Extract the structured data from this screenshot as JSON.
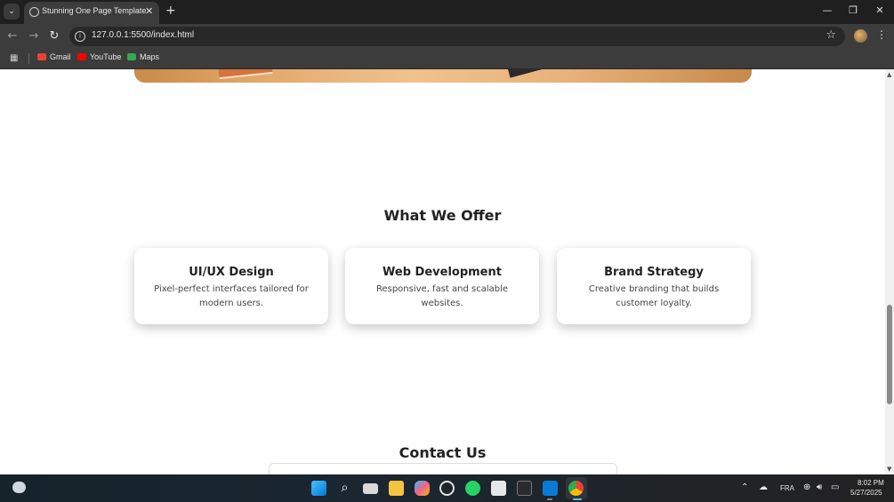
{
  "browser": {
    "tab_title": "Stunning One Page Template",
    "url": "127.0.0.1:5500/index.html",
    "bookmarks": [
      {
        "label": "Gmail",
        "icon": "gmail-icon",
        "color": "#ea4335"
      },
      {
        "label": "YouTube",
        "icon": "youtube-icon",
        "color": "#ff0000"
      },
      {
        "label": "Maps",
        "icon": "maps-icon",
        "color": "#34a853"
      }
    ]
  },
  "page": {
    "offer_title": "What We Offer",
    "cards": [
      {
        "title": "UI/UX Design",
        "desc": "Pixel-perfect interfaces tailored for modern users."
      },
      {
        "title": "Web Development",
        "desc": "Responsive, fast and scalable websites."
      },
      {
        "title": "Brand Strategy",
        "desc": "Creative branding that builds customer loyalty."
      }
    ],
    "contact_title": "Contact Us"
  },
  "taskbar": {
    "apps": [
      "windows-start-icon",
      "search-icon",
      "task-view-icon",
      "file-explorer-icon",
      "copilot-icon",
      "chatgpt-icon",
      "whatsapp-icon",
      "store-icon",
      "terminal-icon",
      "vscode-icon",
      "chrome-icon"
    ],
    "language": "FRA",
    "time": "8:02 PM",
    "date": "5/27/2025"
  },
  "colors": {
    "accent_chrome_dark": "#3c3c3c",
    "page_bg": "#ffffff"
  }
}
